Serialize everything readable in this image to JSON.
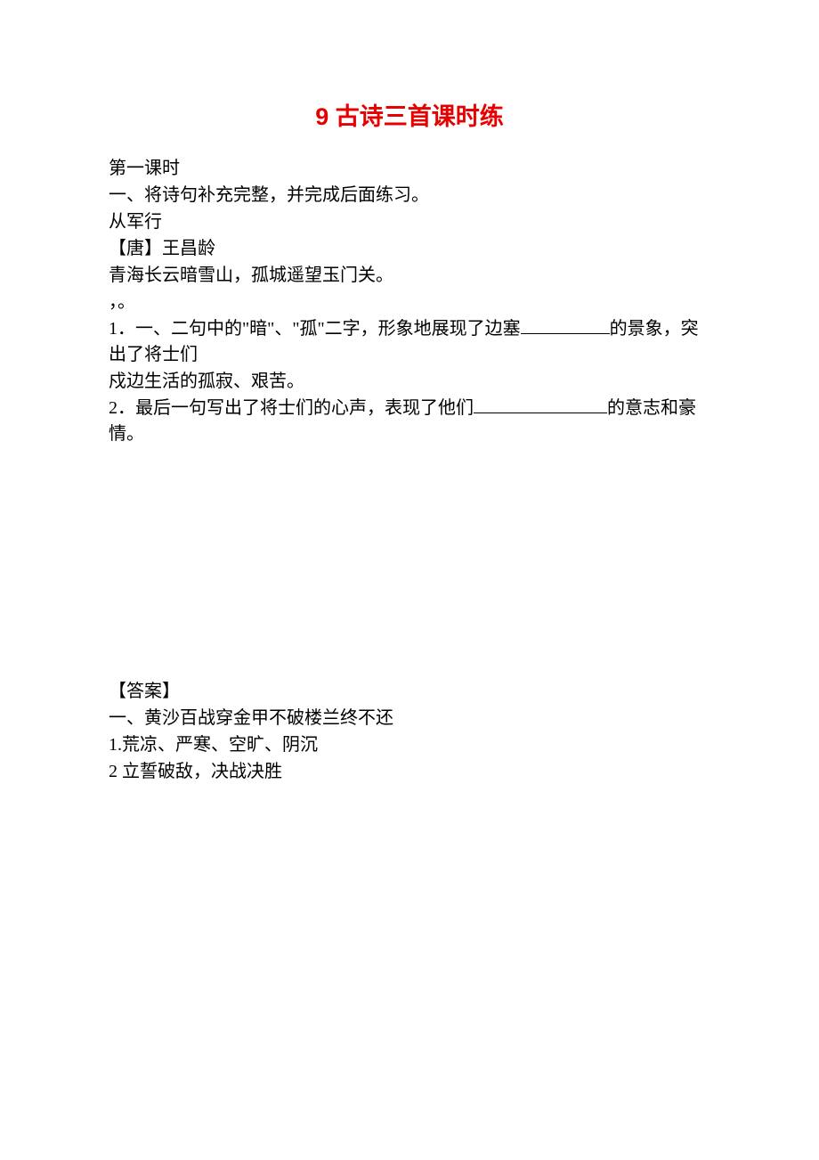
{
  "title": "9 古诗三首课时练",
  "section_label": "第一课时",
  "q1_header": "一、将诗句补充完整，并完成后面练习。",
  "poem_title": "从军行",
  "poem_author": "【唐】王昌龄",
  "poem_line1": "青海长云暗雪山，孤城遥望玉门关。",
  "poem_line2": "，。",
  "q1_1_prefix": "1．一、二句中的\"暗\"、\"孤\"二字，形象地展现了边塞",
  "q1_1_suffix": "的景象，突出了将士们",
  "q1_1_line2": "戍边生活的孤寂、艰苦。",
  "q1_2_prefix": "2．最后一句写出了将士们的心声，表现了他们",
  "q1_2_suffix": "的意志和豪情。",
  "answer_header": "【答案】",
  "answer_1": "一、黄沙百战穿金甲不破楼兰终不还",
  "answer_1_1": "1.荒凉、严寒、空旷、阴沉",
  "answer_1_2": "2 立誓破敌，决战决胜"
}
